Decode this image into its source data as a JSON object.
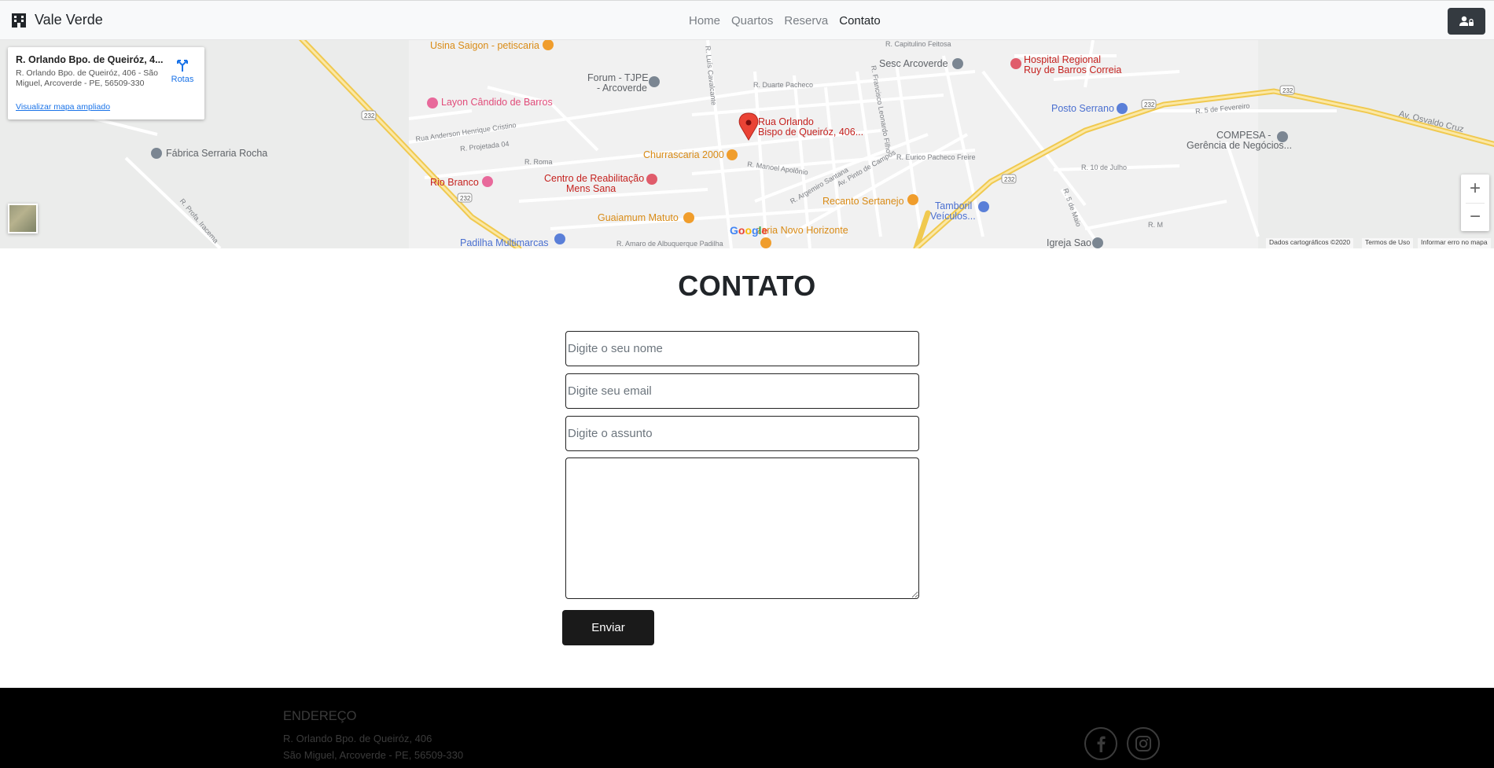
{
  "navbar": {
    "brand": "Vale Verde",
    "links": [
      {
        "label": "Home",
        "active": false
      },
      {
        "label": "Quartos",
        "active": false
      },
      {
        "label": "Reserva",
        "active": false
      },
      {
        "label": "Contato",
        "active": true
      }
    ],
    "user_icon": "user-lock-icon"
  },
  "map": {
    "card": {
      "title": "R. Orlando Bpo. de Queiróz, 4...",
      "address": "R. Orlando Bpo. de Queiróz, 406 - São Miguel, Arcoverde - PE, 56509-330",
      "directions_label": "Rotas",
      "larger_map_link": "Visualizar mapa ampliado"
    },
    "marker_label_1": "Rua Orlando",
    "marker_label_2": "Bispo de Queiróz, 406...",
    "places": {
      "usina": "Usina Saigon - petiscaria",
      "forum_1": "Forum - TJPE",
      "forum_2": "- Arcoverde",
      "sesc": "Sesc Arcoverde",
      "hospital_1": "Hospital Regional",
      "hospital_2": "Ruy de Barros Correia",
      "layon": "Layon Cândido de Barros",
      "posto": "Posto Serrano",
      "compesa_1": "COMPESA -",
      "compesa_2": "Gerência de Negócios...",
      "fabrica": "Fábrica Serraria Rocha",
      "churrascaria": "Churrascaria 2000",
      "centro_1": "Centro de Reabilitação",
      "centro_2": "Mens Sana",
      "rio_branco": "Rio Branco",
      "recanto": "Recanto Sertanejo",
      "tamboril_1": "Tamboril",
      "tamboril_2": "Veículos...",
      "guaiamum": "Guaiamum Matuto",
      "pizzaria": "zaria Novo Horizonte",
      "padilha": "Padilha Multimarcas",
      "igreja": "Igreja Sao"
    },
    "streets": {
      "capitulino": "R. Capitulino Feitosa",
      "luis": "R. Luís Cavalcante",
      "duarte": "R. Duarte Pacheco",
      "anderson": "Rua Anderson Henrique Cristino",
      "projetada": "R. Projetada 04",
      "roma": "R. Roma",
      "manoel": "R. Manoel Apolônio",
      "eurico": "R. Eurico Pacheco Freire",
      "fevereiro": "R. 5 de Fevereiro",
      "julho": "R. 10 de Julho",
      "osvaldo": "Av. Osvaldo Cruz",
      "iracema": "R. Profa. Iracema",
      "amaro": "R. Amaro de Albuquerque Padilha",
      "campos": "Av. Pinto de Campos",
      "argemiro": "R. Argemiro Santana",
      "maio": "R. 5 de Maio",
      "francisco": "R. Francisco Leonardo Filho",
      "rm": "R. M",
      "route": "232"
    },
    "attribution": {
      "data": "Dados cartográficos ©2020",
      "terms": "Termos de Uso",
      "report": "Informar erro no mapa"
    },
    "google_logo": "Google",
    "zoom_in": "+",
    "zoom_out": "−"
  },
  "contact": {
    "title": "CONTATO",
    "name_placeholder": "Digite o seu nome",
    "email_placeholder": "Digite seu email",
    "subject_placeholder": "Digite o assunto",
    "message_value": "",
    "submit_label": "Enviar"
  },
  "footer": {
    "heading": "ENDEREÇO",
    "address_line_1": "R. Orlando Bpo. de Queiróz, 406",
    "address_line_2": "São Miguel, Arcoverde - PE, 56509-330",
    "social": [
      "facebook-icon",
      "instagram-icon"
    ]
  }
}
